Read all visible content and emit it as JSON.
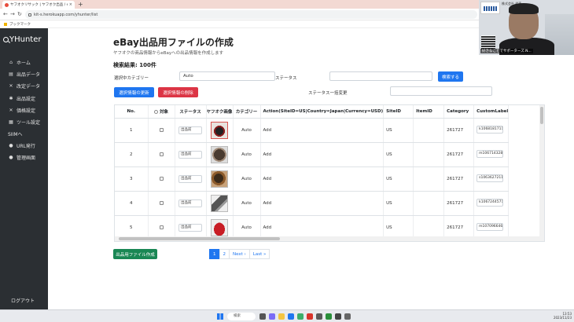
{
  "browser": {
    "tab_title": "ヤフオクリサック | ヤフオク出品 / eBay",
    "url": "kit-s.herokuapp.com/yhunter/list",
    "bookmark": "ブックマーク"
  },
  "sidebar": {
    "brand": "YHunter",
    "items": [
      {
        "label": "ホーム",
        "icon": "home-icon"
      },
      {
        "label": "出品データ",
        "icon": "list-icon"
      },
      {
        "label": "改定データ",
        "icon": "edit-icon"
      },
      {
        "label": "出品設定",
        "icon": "settings-icon"
      },
      {
        "label": "価格設定",
        "icon": "price-icon"
      },
      {
        "label": "ツール設定",
        "icon": "tool-icon"
      },
      {
        "label": "SIIMへ",
        "icon": ""
      },
      {
        "label": "URL発行",
        "icon": "link-icon"
      },
      {
        "label": "管理画面",
        "icon": "admin-icon"
      }
    ],
    "logout": "ログアウト"
  },
  "page": {
    "title": "eBay出品用ファイルの作成",
    "subtitle": "ヤフオクの商品情報からeBayへの出品情報を作成します",
    "result_count": "検索結果: 100件",
    "category_label": "選択中カテゴリー",
    "category_value": "Auto",
    "status_label": "ステータス",
    "status_value": "",
    "search_button": "検索する",
    "update_button": "選択情報の更新",
    "delete_button": "選択情報の削除",
    "bulk_status_label": "ステータス一括変更",
    "bulk_status_value": "",
    "create_file_button": "出品用ファイル作成"
  },
  "table": {
    "headers": [
      "No.",
      "対象",
      "ステータス",
      "ヤフオク画像",
      "カテゴリー",
      "Action(SiteID=US|Country=Japan|Currency=USD)",
      "SiteID",
      "ItemID",
      "Category",
      "CustomLabel"
    ],
    "rows": [
      {
        "no": "1",
        "status": "出品前",
        "category": "Auto",
        "action": "Add",
        "site": "US",
        "item_id": "",
        "ebay_category": "261727",
        "custom_label": "k1068181711"
      },
      {
        "no": "2",
        "status": "出品前",
        "category": "Auto",
        "action": "Add",
        "site": "US",
        "item_id": "",
        "ebay_category": "261727",
        "custom_label": "m1067143281"
      },
      {
        "no": "3",
        "status": "出品前",
        "category": "Auto",
        "action": "Add",
        "site": "US",
        "item_id": "",
        "ebay_category": "261727",
        "custom_label": "s1063627211"
      },
      {
        "no": "4",
        "status": "出品前",
        "category": "Auto",
        "action": "Add",
        "site": "US",
        "item_id": "",
        "ebay_category": "261727",
        "custom_label": "k1067244571"
      },
      {
        "no": "5",
        "status": "出品前",
        "category": "Auto",
        "action": "Add",
        "site": "US",
        "item_id": "",
        "ebay_category": "261727",
        "custom_label": "m1070966461"
      }
    ]
  },
  "pagination": {
    "pages": [
      "1",
      "2"
    ],
    "next": "Next ›",
    "last": "Last »"
  },
  "overlay": {
    "name_tag": "株式会社 代表",
    "caption": "好きなことでサポーターズ.N..."
  },
  "taskbar": {
    "search": "検索",
    "time": "13:53",
    "date": "2023/11/23"
  }
}
